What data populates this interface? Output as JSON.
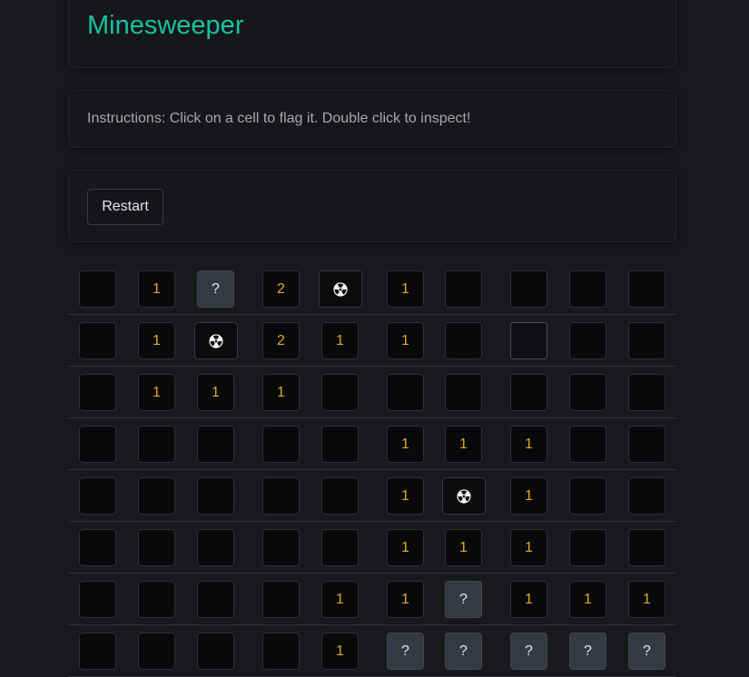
{
  "header": {
    "title": "Minesweeper"
  },
  "instructions": {
    "text": "Instructions: Click on a cell to flag it. Double click to inspect!"
  },
  "controls": {
    "restart_label": "Restart"
  },
  "colors": {
    "title": "#17c2a0",
    "number": "#e3a81d",
    "flag_cell": "#363944",
    "cell": "#08090b",
    "background": "#18191c"
  },
  "icons": {
    "mine": "radiation-icon"
  },
  "board": {
    "rows": [
      [
        "",
        "1",
        "?",
        "2",
        "mine",
        "1",
        "",
        "",
        "",
        ""
      ],
      [
        "",
        "1",
        "mine",
        "2",
        "1",
        "1",
        "",
        "",
        "",
        ""
      ],
      [
        "",
        "1",
        "1",
        "1",
        "",
        "",
        "",
        "",
        "",
        ""
      ],
      [
        "",
        "",
        "",
        "",
        "",
        "1",
        "1",
        "1",
        "",
        ""
      ],
      [
        "",
        "",
        "",
        "",
        "",
        "1",
        "mine",
        "1",
        "",
        ""
      ],
      [
        "",
        "",
        "",
        "",
        "",
        "1",
        "1",
        "1",
        "",
        ""
      ],
      [
        "",
        "",
        "",
        "",
        "1",
        "1",
        "?",
        "1",
        "1",
        "1"
      ],
      [
        "",
        "",
        "",
        "",
        "1",
        "?",
        "?",
        "?",
        "?",
        "?"
      ]
    ]
  }
}
